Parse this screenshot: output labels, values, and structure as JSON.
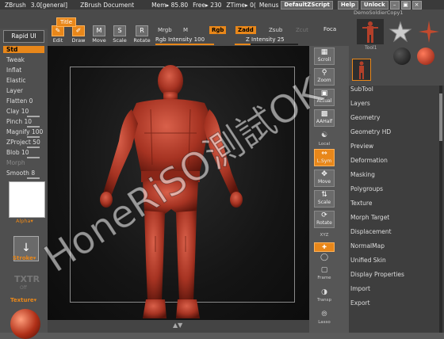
{
  "titlebar": {
    "app": "ZBrush",
    "version": "3.0[general]",
    "doc": "ZBrush Document",
    "mem": "Mem▸ 85.80",
    "free": "Free▸ 230",
    "ztime": "ZTime▸ 0(",
    "menus": "Menus",
    "default_script": "DefaultZScript",
    "help": "Help",
    "unlock": "Unlock"
  },
  "toolbar": {
    "tooltip": "Title",
    "edit": "Edit",
    "draw": "Draw",
    "move": "Move",
    "scale": "Scale",
    "rotate": "Rotate",
    "mrgb": "Mrgb",
    "m": "M",
    "rgb_intensity": "Rgb Intensity 100",
    "rgb": "Rgb",
    "zadd": "Zadd",
    "zsub": "Zsub",
    "zcut": "Zcut",
    "z_intensity": "Z Intensity 25",
    "focal": "Foca"
  },
  "left_palette": {
    "rapid_ui": "Rapid UI",
    "materials": [
      {
        "label": "Std",
        "selected": true
      },
      {
        "label": "Tweak"
      },
      {
        "label": "Inflat"
      },
      {
        "label": "Elastic"
      },
      {
        "label": "Layer"
      },
      {
        "label": "Flatten 0"
      },
      {
        "label": "Clay 10"
      },
      {
        "label": "Pinch 10"
      },
      {
        "label": "Magnify 100"
      },
      {
        "label": "ZProject 50"
      },
      {
        "label": "Blob 10"
      },
      {
        "label": "Morph"
      },
      {
        "label": "Smooth 8"
      }
    ],
    "alpha": "Alpha▾",
    "stroke": "Stroke▾",
    "txtr": "TXTR",
    "off": "Off",
    "texture": "Texture▾"
  },
  "shelf": {
    "scroll": "Scroll",
    "zoom": "Zoom",
    "actual": "Actual",
    "aahalf": "AAHalf",
    "local": "Local",
    "lsym": "L.Sym",
    "move": "Move",
    "scale": "Scale",
    "rotate": "Rotate",
    "xyz": "XYZ",
    "frame": "Frame",
    "transp": "Transp",
    "lasso": "Lasso"
  },
  "tool_panel": {
    "tool_name": "DemoSoldierCopy1",
    "thumb_label": "Tool1",
    "items": [
      "SubTool",
      "Layers",
      "Geometry",
      "Geometry HD",
      "Preview",
      "Deformation",
      "Masking",
      "Polygroups",
      "Texture",
      "Morph Target",
      "Displacement",
      "NormalMap",
      "Unified Skin",
      "Display Properties",
      "Import",
      "Export"
    ]
  },
  "watermark": "HoneRiSO測試OK",
  "colors": {
    "accent": "#e8871a",
    "model": "#b3402a",
    "background": "#5a5a5a"
  }
}
